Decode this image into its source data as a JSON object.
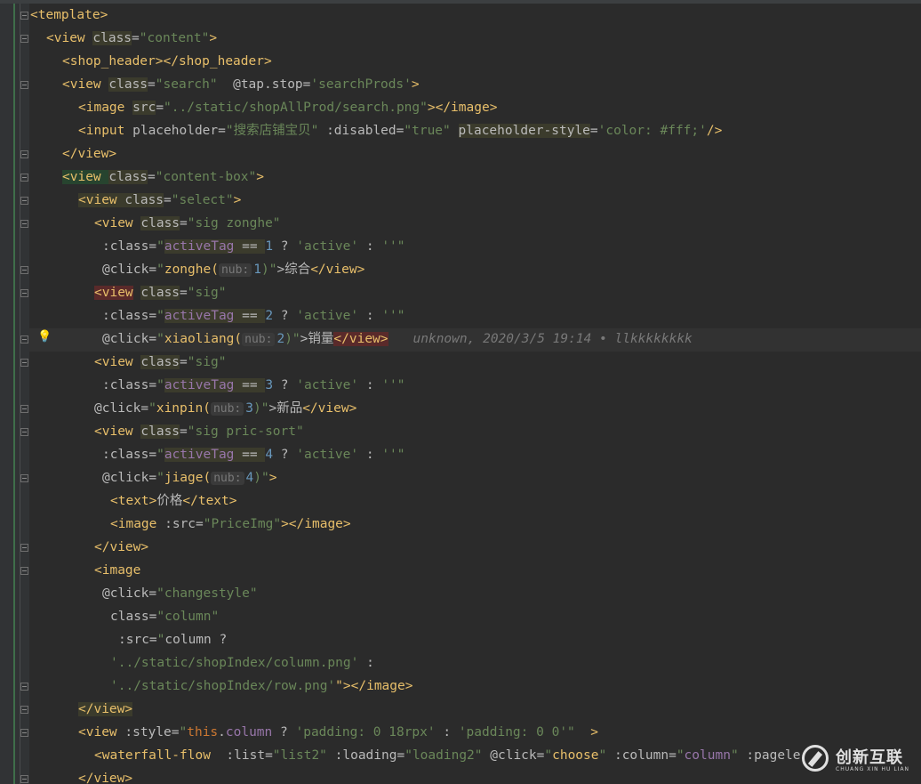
{
  "editor": {
    "lines": [
      [
        "<template>"
      ],
      [
        "<view ",
        "class",
        "=",
        "\"content\"",
        ">"
      ],
      [
        "<shop_header></shop_header>"
      ],
      [
        "<view ",
        "class",
        "=",
        "\"search\"",
        "  @tap.stop=",
        "'searchProds'",
        ">"
      ],
      [
        "<image ",
        "src",
        "=",
        "\"../static/shopAllProd/search.png\"",
        "></image>"
      ],
      [
        "<input ",
        "placeholder=",
        "\"搜索店铺宝贝\"",
        " :disabled=",
        "\"true\"",
        " ",
        "placeholder-style",
        "=",
        "'color: #fff;'",
        "/>"
      ],
      [
        "</view>"
      ],
      [
        "<view ",
        "class",
        "=",
        "\"content-box\"",
        ">"
      ],
      [
        "<view ",
        "class",
        "=",
        "\"select\"",
        ">"
      ],
      [
        "<view ",
        "class",
        "=",
        "\"sig zonghe\""
      ],
      [
        ":class=",
        "\"",
        "activeTag",
        " == ",
        "1",
        " ? ",
        "'active'",
        " : ",
        "''",
        "\""
      ],
      [
        "@click=",
        "\"",
        "zonghe(",
        "nub:",
        "1",
        ")\"",
        ">综合",
        "</view>"
      ],
      [
        "<view",
        " ",
        "class",
        "=",
        "\"sig\""
      ],
      [
        ":class=",
        "\"",
        "activeTag",
        " == ",
        "2",
        " ? ",
        "'active'",
        " : ",
        "''",
        "\""
      ],
      [
        "@click=",
        "\"",
        "xiaoliang(",
        "nub:",
        "2",
        ")\"",
        ">销量",
        "</view>",
        "unknown, 2020/3/5 19:14 • llkkkkkkkk"
      ],
      [
        "<view ",
        "class",
        "=",
        "\"sig\""
      ],
      [
        ":class=",
        "\"",
        "activeTag",
        " == ",
        "3",
        " ? ",
        "'active'",
        " : ",
        "''",
        "\""
      ],
      [
        "@click=",
        "\"",
        "xinpin(",
        "nub:",
        "3",
        ")\"",
        ">新品",
        "</view>"
      ],
      [
        "<view ",
        "class",
        "=",
        "\"sig pric-sort\""
      ],
      [
        ":class=",
        "\"",
        "activeTag",
        " == ",
        "4",
        " ? ",
        "'active'",
        " : ",
        "''",
        "\""
      ],
      [
        "@click=",
        "\"",
        "jiage(",
        "nub:",
        "4",
        ")\"",
        ">"
      ],
      [
        "<text>",
        "价格",
        "</text>"
      ],
      [
        "<image ",
        ":src=",
        "\"PriceImg\"",
        "></image>"
      ],
      [
        "</view>"
      ],
      [
        "<image"
      ],
      [
        "@click=",
        "\"changestyle\""
      ],
      [
        "class=",
        "\"column\""
      ],
      [
        ":src=",
        "\"",
        "column ?"
      ],
      [
        "'../static/shopIndex/column.png'",
        " :"
      ],
      [
        "'../static/shopIndex/row.png'",
        "\"></image>"
      ],
      [
        "</view>"
      ],
      [
        "<view ",
        ":style=",
        "\"",
        "this",
        ".",
        "column",
        " ? ",
        "'padding: 0 18rpx'",
        " : ",
        "'padding: 0 0'",
        "\"",
        "  >"
      ],
      [
        "<waterfall-flow ",
        " :list=",
        "\"list2\"",
        " :loading=",
        "\"loading2\"",
        " @click=",
        "\"",
        "choose",
        "\"",
        " :column=",
        "\"",
        "column",
        "\"",
        " :pag",
        "ele"
      ],
      [
        "</view>"
      ]
    ]
  },
  "watermark": {
    "chinese": "创新互联",
    "english": "CHUANG XIN HU LIAN"
  }
}
